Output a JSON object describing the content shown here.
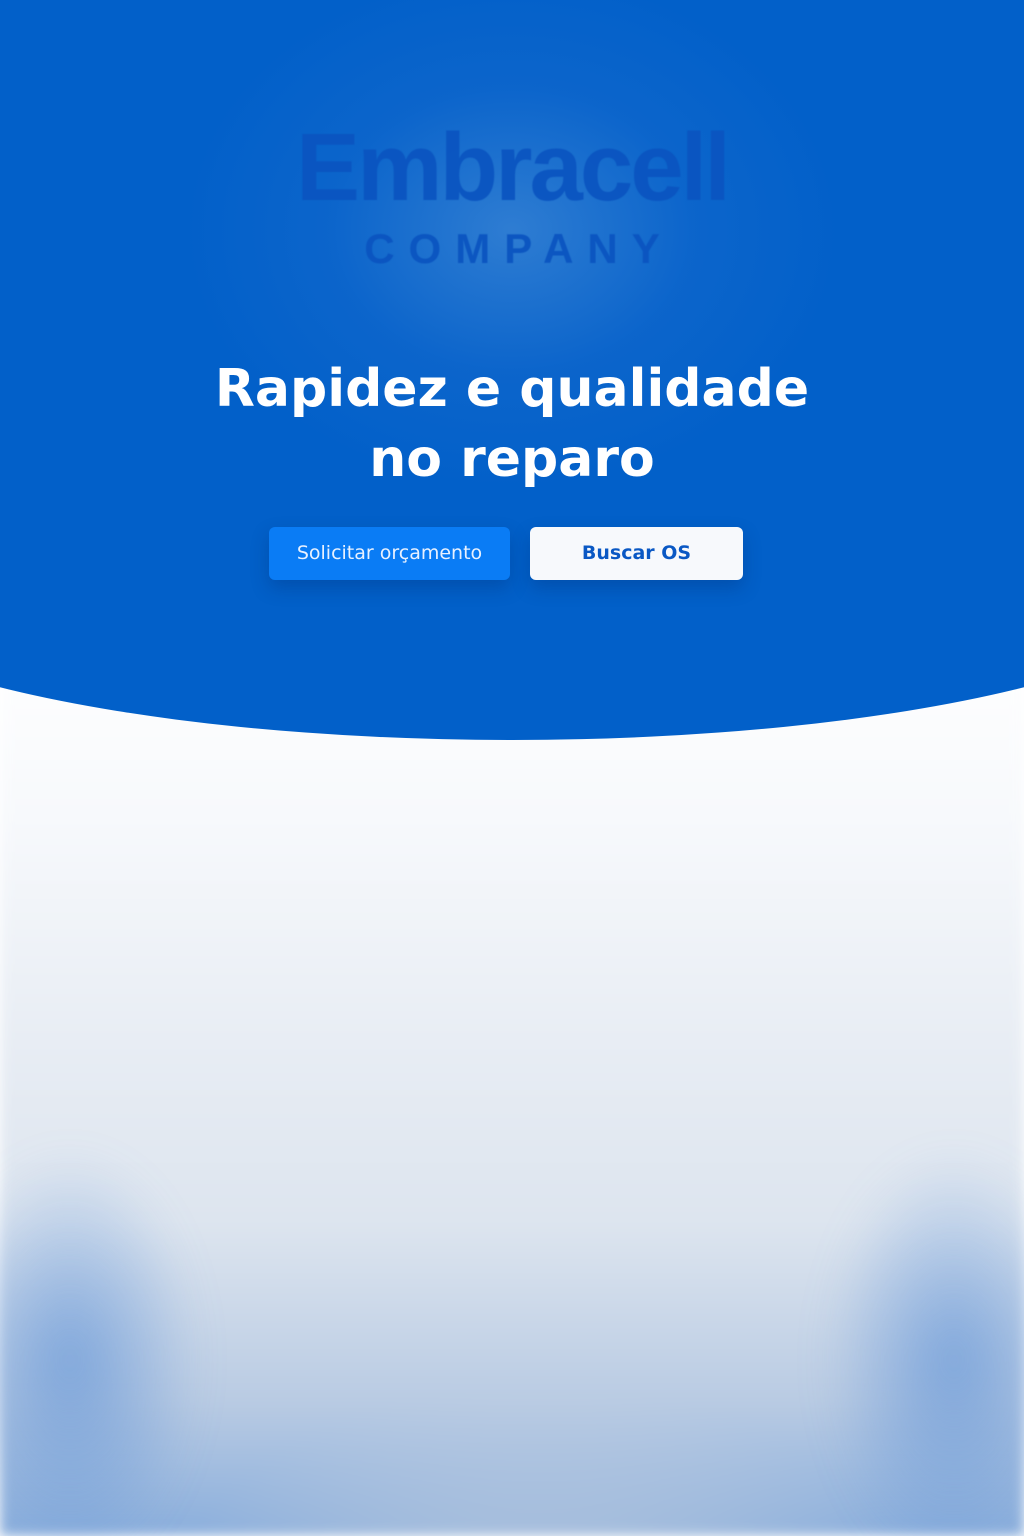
{
  "brand": {
    "name": "Embracell",
    "tagline": "COMPANY"
  },
  "hero": {
    "headline_line1": "Rapidez e qualidade",
    "headline_line2": "no reparo"
  },
  "actions": {
    "primary_label": "Solicitar orçamento",
    "secondary_label": "Buscar OS"
  },
  "colors": {
    "hero_blue": "#0260c9",
    "primary_button": "#0a7cf5",
    "secondary_button": "#f7f9fc",
    "secondary_text": "#0a58c4"
  }
}
